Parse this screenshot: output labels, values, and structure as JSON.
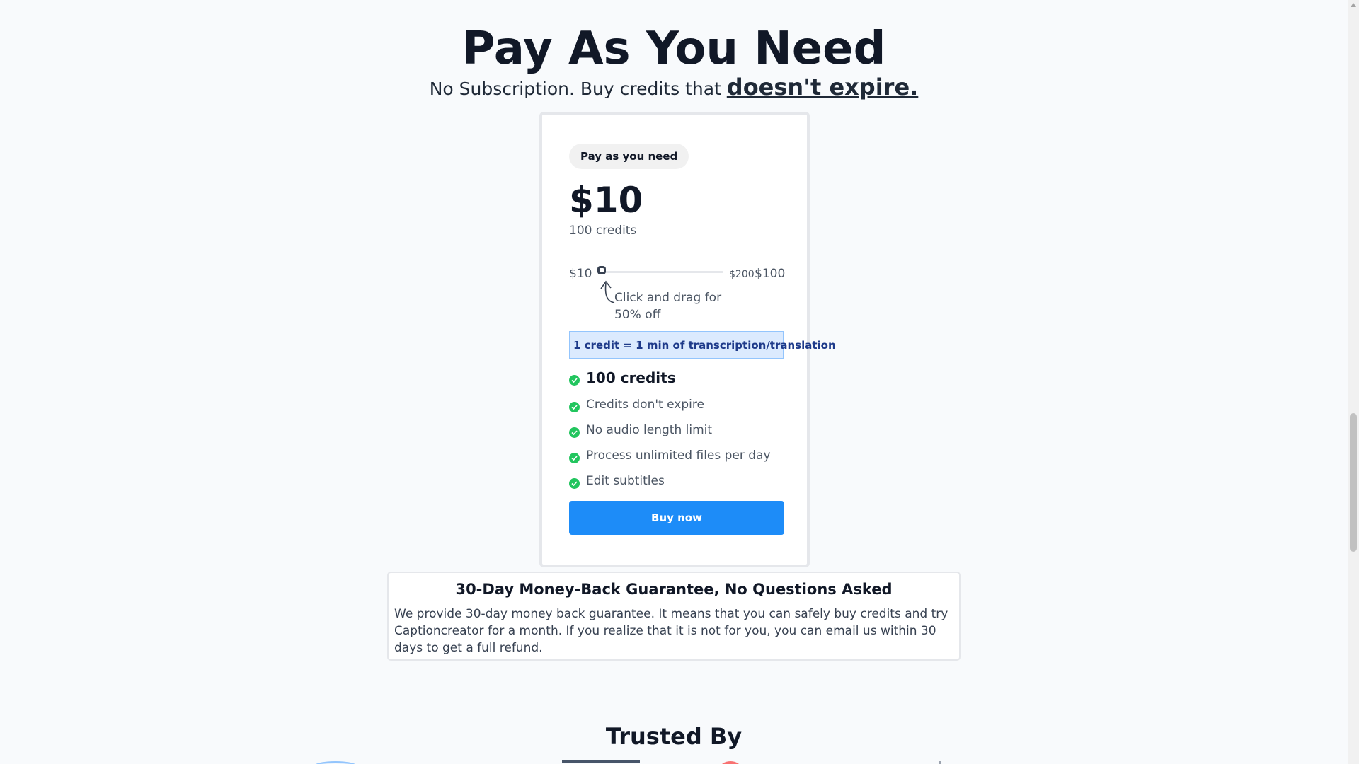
{
  "header": {
    "title": "Pay As You Need",
    "subtitle_prefix": "No Subscription. Buy credits that ",
    "subtitle_emphasis": "doesn't expire."
  },
  "pricing_card": {
    "plan_badge": "Pay as you need",
    "price": "$10",
    "credits_label": "100 credits",
    "slider": {
      "min_label": "$10",
      "old_price": "$200",
      "max_label": "$100",
      "value_fraction": 0
    },
    "hint_text": "Click and drag for 50% off",
    "credit_info": "1 credit = 1 min of transcription/translation",
    "features": [
      "100 credits",
      "Credits don't expire",
      "No audio length limit",
      "Process unlimited files per day",
      "Edit subtitles"
    ],
    "buy_label": "Buy now"
  },
  "guarantee": {
    "title": "30-Day Money-Back Guarantee, No Questions Asked",
    "body": "We provide 30-day money back guarantee. It means that you can safely buy credits and try Captioncreator for a month. If you realize that it is not for you, you can email us within 30 days to get a full refund."
  },
  "trusted": {
    "title": "Trusted By"
  },
  "colors": {
    "accent": "#1d8cf8",
    "check": "#22c55e",
    "info_bg": "#dbeafe"
  }
}
